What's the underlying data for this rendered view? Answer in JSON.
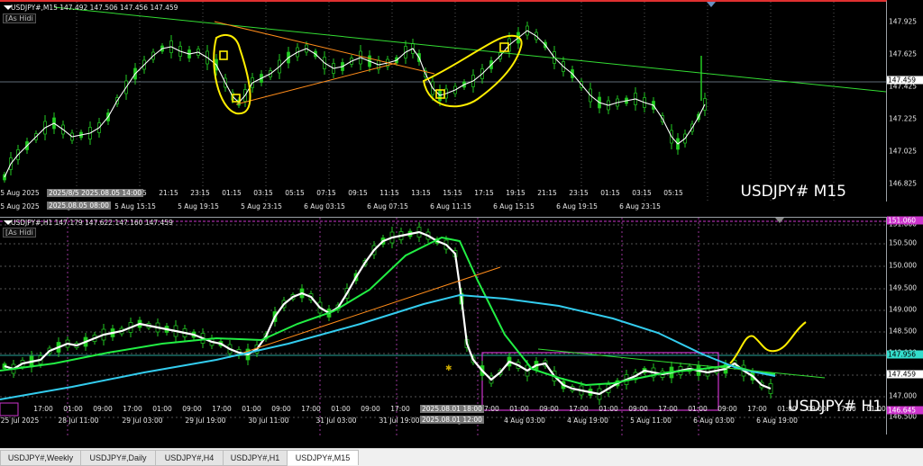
{
  "top_chart": {
    "header": "USDJPY#,M15  147.492 147.506 147.456 147.459",
    "hide_label": "[As Hidi",
    "watermark": "USDJPY# M15",
    "price_labels": [
      "147.925",
      "147.625",
      "147.425",
      "147.225",
      "147.025",
      "146.825"
    ],
    "current_price": "147.459",
    "time_labels": [
      "5 Aug 2025",
      "5 Aug 11:15",
      "19:15",
      "21:15",
      "23:15",
      "01:15",
      "03:15",
      "05:15",
      "07:15",
      "09:15",
      "11:15",
      "13:15",
      "15:15",
      "17:15",
      "19:15",
      "21:15",
      "23:15",
      "01:15",
      "03:15",
      "05:15"
    ],
    "bottom_time_labels": [
      "5 Aug 2025",
      "5 Aug 11:15",
      "5 Aug 15:15",
      "5 Aug 19:15",
      "5 Aug 23:15",
      "6 Aug 03:15",
      "6 Aug 07:15",
      "6 Aug 11:15",
      "6 Aug 15:15",
      "6 Aug 19:15",
      "6 Aug 23:15"
    ],
    "crosshair_date_top": "2025/8/5  2025.08.05 14:00",
    "crosshair_date_bottom": "2025.08.05 08:00"
  },
  "bottom_chart": {
    "header": "USDJPY#,H1  147.179 147.622 147.160 147.459",
    "hide_label": "[As Hidi",
    "watermark": "USDJPY# H1",
    "price_labels": [
      "151.000",
      "150.500",
      "150.000",
      "149.500",
      "149.000",
      "148.500",
      "148.000",
      "147.500",
      "147.000",
      "146.500"
    ],
    "top_marker": "151.060",
    "level_cyan": "147.956",
    "current_price": "147.459",
    "bottom_marker": "146.645",
    "time_labels": [
      "25 Jul 2025",
      "28 Jul 11:00",
      "29 Jul 03:00",
      "29 Jul 19:00",
      "30 Jul 11:00",
      "31 Jul 03:00",
      "31 Jul 19:00",
      "1 Aug 2025",
      "4 Aug 03:00",
      "4 Aug 19:00",
      "5 Aug 11:00",
      "6 Aug 03:00",
      "6 Aug 19:00"
    ],
    "hour_labels": [
      "17:00",
      "01:00",
      "09:00",
      "17:00",
      "01:00",
      "09:00",
      "17:00",
      "01:00",
      "09:00",
      "17:00",
      "01:00",
      "09:00",
      "17:00",
      "01:00",
      "09:00",
      "17:00",
      "01:00",
      "09:00",
      "17:00",
      "01:00",
      "09:00",
      "17:00",
      "01:00",
      "09:00",
      "17:00",
      "01:00",
      "09:00",
      "17:00",
      "01:00"
    ],
    "crosshair_date_top": "2025.08.01 18:00",
    "crosshair_date_bottom": "2025.08.01 12:00"
  },
  "tabs": [
    "USDJPY#,Weekly",
    "USDJPY#,Daily",
    "USDJPY#,H4",
    "USDJPY#,H1",
    "USDJPY#,M15"
  ],
  "active_tab": "USDJPY#,M15",
  "colors": {
    "candle": "#22cc22",
    "ma_white": "#ffffff",
    "ma_green": "#22ee44",
    "ma_cyan": "#33ccee",
    "trend_orange": "#ff8c1a",
    "trend_green": "#33dd33",
    "annotation_yellow": "#ffee00",
    "box_magenta": "#cc33cc",
    "level_cyan": "#33ddcc"
  }
}
